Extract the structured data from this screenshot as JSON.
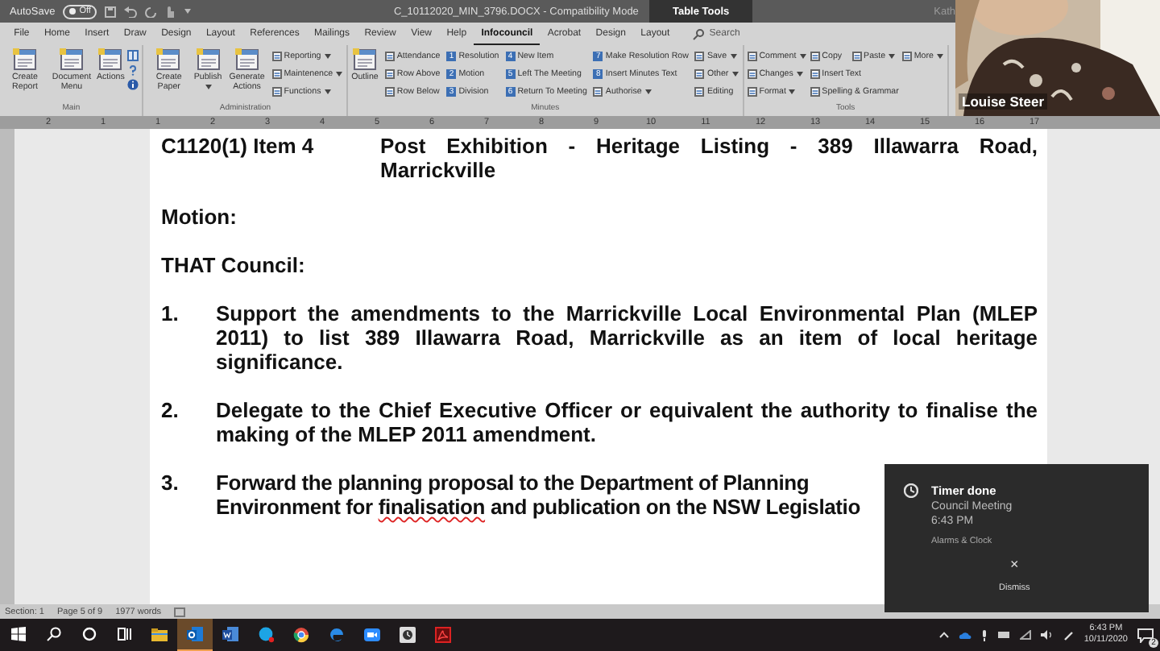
{
  "title_bar": {
    "autosave_label": "AutoSave",
    "autosave": {
      "on": false,
      "label": "Off"
    },
    "document_title": "C_10112020_MIN_3796.DOCX  -  Compatibility Mode",
    "context_tab": "Table Tools",
    "user": "Kath"
  },
  "ribbon_tabs": [
    {
      "label": "File",
      "selected": false
    },
    {
      "label": "Home",
      "selected": false
    },
    {
      "label": "Insert",
      "selected": false
    },
    {
      "label": "Draw",
      "selected": false
    },
    {
      "label": "Design",
      "selected": false
    },
    {
      "label": "Layout",
      "selected": false
    },
    {
      "label": "References",
      "selected": false
    },
    {
      "label": "Mailings",
      "selected": false
    },
    {
      "label": "Review",
      "selected": false
    },
    {
      "label": "View",
      "selected": false
    },
    {
      "label": "Help",
      "selected": false
    },
    {
      "label": "Infocouncil",
      "selected": true
    },
    {
      "label": "Acrobat",
      "selected": false
    },
    {
      "label": "Design",
      "selected": false
    },
    {
      "label": "Layout",
      "selected": false
    }
  ],
  "search": {
    "placeholder": "Search"
  },
  "ribbon_groups": [
    {
      "name": "Main",
      "columns": [
        {
          "kind": "large",
          "label": "Create Report"
        },
        {
          "kind": "large",
          "label": "Document Menu"
        },
        {
          "kind": "large",
          "label": "Actions"
        },
        {
          "kind": "icon-stack"
        }
      ]
    },
    {
      "name": "Administration",
      "columns": [
        {
          "kind": "large",
          "label": "Create Paper"
        },
        {
          "kind": "large",
          "label": "Publish",
          "dropdown": true
        },
        {
          "kind": "large",
          "label": "Generate Actions"
        },
        {
          "kind": "stack",
          "items": [
            {
              "label": "Reporting",
              "dropdown": true
            },
            {
              "label": "Maintenence",
              "dropdown": true
            },
            {
              "label": "Functions",
              "dropdown": true
            }
          ]
        }
      ]
    },
    {
      "name": "Minutes",
      "columns": [
        {
          "kind": "large",
          "label": "Outline"
        },
        {
          "kind": "stack",
          "items": [
            {
              "label": "Attendance"
            },
            {
              "label": "Row Above"
            },
            {
              "label": "Row Below"
            }
          ]
        },
        {
          "kind": "stack",
          "items": [
            {
              "num": "1",
              "label": "Resolution"
            },
            {
              "num": "2",
              "label": "Motion"
            },
            {
              "num": "3",
              "label": "Division"
            }
          ]
        },
        {
          "kind": "stack",
          "items": [
            {
              "num": "4",
              "label": "New Item"
            },
            {
              "num": "5",
              "label": "Left The Meeting"
            },
            {
              "num": "6",
              "label": "Return To Meeting"
            }
          ]
        },
        {
          "kind": "stack",
          "items": [
            {
              "num": "7",
              "label": "Make Resolution Row"
            },
            {
              "num": "8",
              "label": "Insert Minutes Text"
            },
            {
              "label": "Authorise",
              "dropdown": true
            }
          ]
        },
        {
          "kind": "stack",
          "items": [
            {
              "label": "Save",
              "dropdown": true
            },
            {
              "label": "Other",
              "dropdown": true
            },
            {
              "label": "Editing"
            }
          ]
        }
      ]
    },
    {
      "name": "Tools",
      "columns": [
        {
          "kind": "stack",
          "items": [
            {
              "label": "Comment",
              "dropdown": true
            },
            {
              "label": "Changes",
              "dropdown": true
            },
            {
              "label": "Format",
              "dropdown": true
            }
          ]
        },
        {
          "kind": "row-stack",
          "rows": [
            [
              {
                "label": "Copy"
              },
              {
                "label": "Paste",
                "dropdown": true
              }
            ],
            [
              {
                "label": "Insert Text"
              }
            ],
            [
              {
                "label": "Spelling & Grammar"
              }
            ]
          ]
        },
        {
          "kind": "stack",
          "items": [
            {
              "label": "More",
              "dropdown": true
            }
          ]
        }
      ]
    }
  ],
  "ruler": [
    "2",
    "1",
    "1",
    "2",
    "3",
    "4",
    "5",
    "6",
    "7",
    "8",
    "9",
    "10",
    "11",
    "12",
    "13",
    "14",
    "15",
    "16",
    "17"
  ],
  "video": {
    "participant": "Louise Steer"
  },
  "document": {
    "item_number": "C1120(1) Item 4",
    "item_title": "Post Exhibition - Heritage Listing - 389 Illawarra Road, Marrickville",
    "motion_label": "Motion:",
    "intro": "THAT Council:",
    "resolutions": [
      {
        "kind": "full",
        "number": "1.",
        "text": "Support the amendments to the Marrickville Local Environmental Plan (MLEP 2011) to list 389 Illawarra Road, Marrickville as an item of local heritage significance."
      },
      {
        "kind": "full",
        "number": "2.",
        "text": "Delegate to the Chief Executive Officer or equivalent the authority to finalise the making of the MLEP 2011 amendment."
      },
      {
        "kind": "partial",
        "number": "3.",
        "lines": [
          [
            {
              "text": "Forward the planning proposal to the Department of Planning",
              "misspelled": false
            }
          ],
          [
            {
              "text": "Environment for ",
              "misspelled": false
            },
            {
              "text": "finalisation",
              "misspelled": true
            },
            {
              "text": " and publication on the NSW Legislatio",
              "misspelled": false
            }
          ]
        ]
      }
    ]
  },
  "notification": {
    "title": "Timer done",
    "lines": [
      "Council Meeting",
      "6:43 PM"
    ],
    "app": "Alarms & Clock",
    "close": "×",
    "action": "Dismiss"
  },
  "status_bar": [
    "Section: 1",
    "Page 5 of 9",
    "1977 words"
  ],
  "taskbar": {
    "apps": [
      {
        "selected": false
      },
      {
        "selected": true
      },
      {
        "selected": false
      },
      {
        "selected": false
      },
      {
        "selected": false
      },
      {
        "selected": false
      },
      {
        "selected": false
      },
      {
        "selected": false
      },
      {
        "selected": false
      }
    ],
    "time": "6:43 PM",
    "date": "10/11/2020",
    "notifications": "2"
  }
}
